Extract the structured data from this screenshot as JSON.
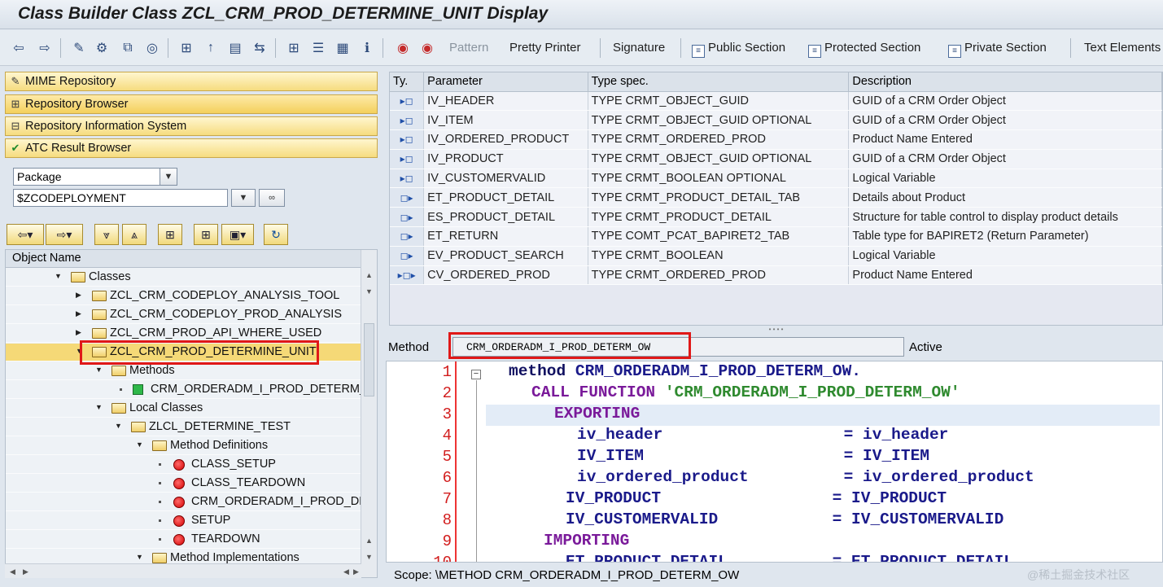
{
  "window": {
    "title": "Class Builder Class ZCL_CRM_PROD_DETERMINE_UNIT Display"
  },
  "toolbar": {
    "icons": [
      "back-arrow-icon",
      "forward-arrow-icon",
      "change-icon",
      "other-object-icon",
      "activate-icon",
      "where-used-icon",
      "hierarchy-icon",
      "enhance-icon",
      "display-object-list-icon",
      "navigate-icon",
      "object-tree-icon",
      "repository-icon",
      "layout-icon",
      "info-icon",
      "source-code-icon",
      "breakpoint-icon"
    ],
    "pattern": "Pattern",
    "pretty_printer": "Pretty Printer",
    "signature": "Signature",
    "public_section": "Public Section",
    "protected_section": "Protected Section",
    "private_section": "Private Section",
    "text_elements": "Text Elements"
  },
  "navigator": {
    "buttons": [
      "MIME Repository",
      "Repository Browser",
      "Repository Information System",
      "ATC Result Browser"
    ],
    "object_type": "Package",
    "object_value": "$ZCODEPLOYMENT"
  },
  "tree": {
    "header": "Object Name",
    "rows": [
      {
        "label": "Classes",
        "level": 0
      },
      {
        "label": "ZCL_CRM_CODEPLOY_ANALYSIS_TOOL",
        "level": 1
      },
      {
        "label": "ZCL_CRM_CODEPLOY_PROD_ANALYSIS",
        "level": 1
      },
      {
        "label": "ZCL_CRM_PROD_API_WHERE_USED",
        "level": 1
      },
      {
        "label": "ZCL_CRM_PROD_DETERMINE_UNIT",
        "level": 1
      },
      {
        "label": "Methods",
        "level": 2
      },
      {
        "label": "CRM_ORDERADM_I_PROD_DETERM_OW",
        "level": 3
      },
      {
        "label": "Local Classes",
        "level": 2
      },
      {
        "label": "ZLCL_DETERMINE_TEST",
        "level": 3
      },
      {
        "label": "Method Definitions",
        "level": 4
      },
      {
        "label": "CLASS_SETUP",
        "level": 5
      },
      {
        "label": "CLASS_TEARDOWN",
        "level": 5
      },
      {
        "label": "CRM_ORDERADM_I_PROD_DETERM_OW",
        "level": 5
      },
      {
        "label": "SETUP",
        "level": 5
      },
      {
        "label": "TEARDOWN",
        "level": 5
      },
      {
        "label": "Method Implementations",
        "level": 4
      }
    ]
  },
  "params": {
    "columns": [
      "Ty.",
      "Parameter",
      "Type spec.",
      "Description"
    ],
    "rows": [
      [
        "IV_HEADER",
        "TYPE CRMT_OBJECT_GUID",
        "GUID of a CRM Order Object"
      ],
      [
        "IV_ITEM",
        "TYPE CRMT_OBJECT_GUID OPTIONAL",
        "GUID of a CRM Order Object"
      ],
      [
        "IV_ORDERED_PRODUCT",
        "TYPE CRMT_ORDERED_PROD",
        "Product Name Entered"
      ],
      [
        "IV_PRODUCT",
        "TYPE CRMT_OBJECT_GUID OPTIONAL",
        "GUID of a CRM Order Object"
      ],
      [
        "IV_CUSTOMERVALID",
        "TYPE CRMT_BOOLEAN OPTIONAL",
        "Logical Variable"
      ],
      [
        "ET_PRODUCT_DETAIL",
        "TYPE CRMT_PRODUCT_DETAIL_TAB",
        "Details about Product"
      ],
      [
        "ES_PRODUCT_DETAIL",
        "TYPE CRMT_PRODUCT_DETAIL",
        "Structure for table control to display product details"
      ],
      [
        "ET_RETURN",
        "TYPE COMT_PCAT_BAPIRET2_TAB",
        "Table type for BAPIRET2 (Return Parameter)"
      ],
      [
        "EV_PRODUCT_SEARCH",
        "TYPE CRMT_BOOLEAN",
        "Logical Variable"
      ],
      [
        "CV_ORDERED_PROD",
        "TYPE CRMT_ORDERED_PROD",
        "Product Name Entered"
      ]
    ]
  },
  "method": {
    "label": "Method",
    "name": "CRM_ORDERADM_I_PROD_DETERM_OW",
    "status": "Active"
  },
  "code": {
    "line_numbers": [
      "1",
      "2",
      "3",
      "4",
      "5",
      "6",
      "7",
      "8",
      "9",
      "10"
    ],
    "fold_marker": "−",
    "l1_kw": "method",
    "l1_rest": " CRM_ORDERADM_I_PROD_DETERM_OW.",
    "l2_kw": "CALL FUNCTION",
    "l2_str": "'CRM_ORDERADM_I_PROD_DETERM_OW'",
    "l3_kw": "EXPORTING",
    "l4": "iv_header                   = iv_header",
    "l5": "IV_ITEM                     = IV_ITEM",
    "l6": "iv_ordered_product          = iv_ordered_product",
    "l7": "IV_PRODUCT                  = IV_PRODUCT",
    "l8": "IV_CUSTOMERVALID            = IV_CUSTOMERVALID",
    "l9_kw": "IMPORTING",
    "l10": "ET_PRODUCT_DETAIL           = ET_PRODUCT_DETAIL"
  },
  "status": {
    "scope": "Scope: \\METHOD CRM_ORDERADM_I_PROD_DETERM_OW"
  },
  "watermark": "@稀土掘金技术社区",
  "colors": {
    "highlight_box": "#e01818",
    "selection": "#f5d977",
    "keyword": "#7a1a9a",
    "string": "#2f8a2f"
  }
}
